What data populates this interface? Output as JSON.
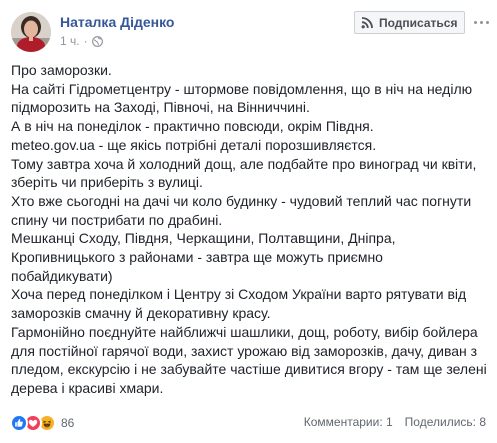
{
  "header": {
    "author": "Наталка Діденко",
    "time": "1 ч.",
    "dot": "·",
    "privacy_icon": "globe-icon",
    "subscribe_label": "Подписаться",
    "subscribe_icon": "rss-icon",
    "more_icon": "more-options-icon"
  },
  "post": {
    "lines": [
      "Про заморозки.",
      "На сайті Гідрометцентру - штормове повідомлення, що в ніч на неділю",
      "підморозить на Заході, Півночі, на Вінниччині.",
      "А в ніч на понеділок - практично повсюди, окрім Півдня.",
      "meteo.gov.ua - ще якісь потрібні деталі порозшивляєтся.",
      "Тому завтра хоча й холодний дощ, але подбайте про виноград чи квіти,",
      "зберіть чи приберіть з вулиці.",
      "Хто вже сьогодні на дачі чи коло будинку - чудовий теплий час погнути",
      "спину чи пострибати по драбині.",
      "Мешканці Сходу, Півдня, Черкащини, Полтавщини, Дніпра,",
      "Кропивницького з районами - завтра ще можуть приємно",
      "побайдикувати)",
      "Хоча перед понеділком і Центру зі Сходом України варто рятувати від",
      "заморозків смачну й декоративну красу.",
      "Гармонійно поєднуйте найближчі шашлики, дощ, роботу, вибір бойлера",
      "для постійної гарячої води, захист урожаю від заморозків, дачу, диван з",
      "пледом, екскурсію і не забувайте частіше дивитися вгору - там ще зелені",
      "дерева і красиві хмари."
    ]
  },
  "footer": {
    "reaction_icons": [
      "like-reaction-icon",
      "love-reaction-icon",
      "haha-reaction-icon"
    ],
    "reactions_count": "86",
    "comments": "Комментарии: 1",
    "shares": "Поделились: 8"
  },
  "colors": {
    "author_link": "#365899",
    "meta_gray": "#90949c",
    "text": "#1d2129",
    "like": "#2078f4",
    "love": "#f33e58",
    "haha": "#f7b125"
  }
}
